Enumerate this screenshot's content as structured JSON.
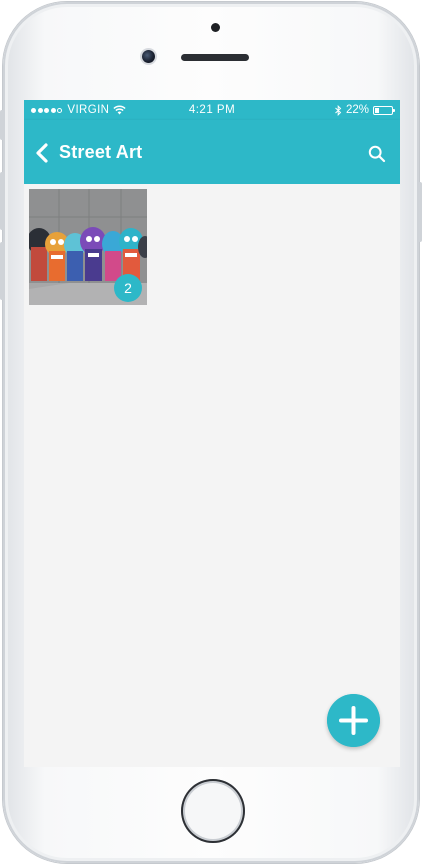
{
  "status_bar": {
    "carrier": "VIRGIN",
    "time": "4:21 PM",
    "battery": "22%",
    "battery_level": 0.22,
    "signal_bars_filled": 4,
    "signal_bars_total": 5
  },
  "nav": {
    "title": "Street Art",
    "back_icon": "chevron-left-icon",
    "search_icon": "search-icon"
  },
  "album": {
    "items": [
      {
        "count": "2",
        "image": "street-art-mural-photo"
      }
    ]
  },
  "fab": {
    "icon": "plus-icon"
  },
  "colors": {
    "accent": "#2db8c8",
    "background": "#f4f4f4"
  }
}
